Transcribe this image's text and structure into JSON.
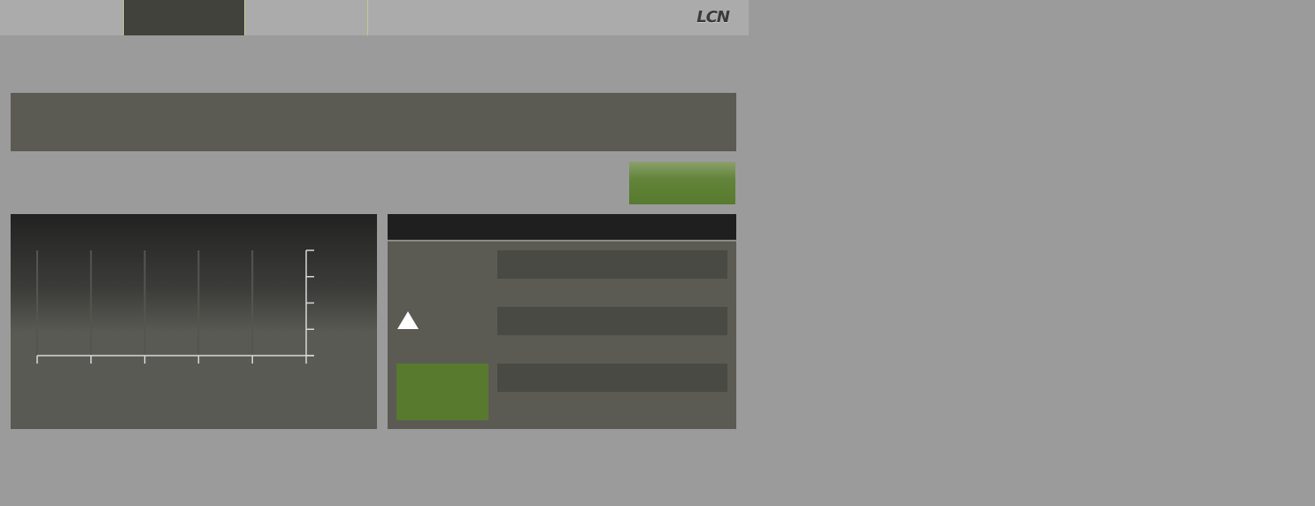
{
  "header": {
    "logo_text": "LCN",
    "tabs": [
      {
        "label": "",
        "active": false
      },
      {
        "label": "",
        "active": true
      },
      {
        "label": "",
        "active": false
      }
    ]
  },
  "colors": {
    "page_background": "#9b9b9b",
    "header_background": "#ababab",
    "active_tab": "#42423c",
    "tab_divider": "#b8d08a",
    "panel": "#5b5b54",
    "accent_green": "#587a2f"
  },
  "chart": {
    "x_tick_count": 6,
    "y_tick_count": 5,
    "vertical_gridlines": true
  },
  "form": {
    "fields": [
      {
        "value": ""
      },
      {
        "value": ""
      },
      {
        "value": ""
      }
    ]
  },
  "icons": {
    "triangle": "triangle-up-icon"
  }
}
